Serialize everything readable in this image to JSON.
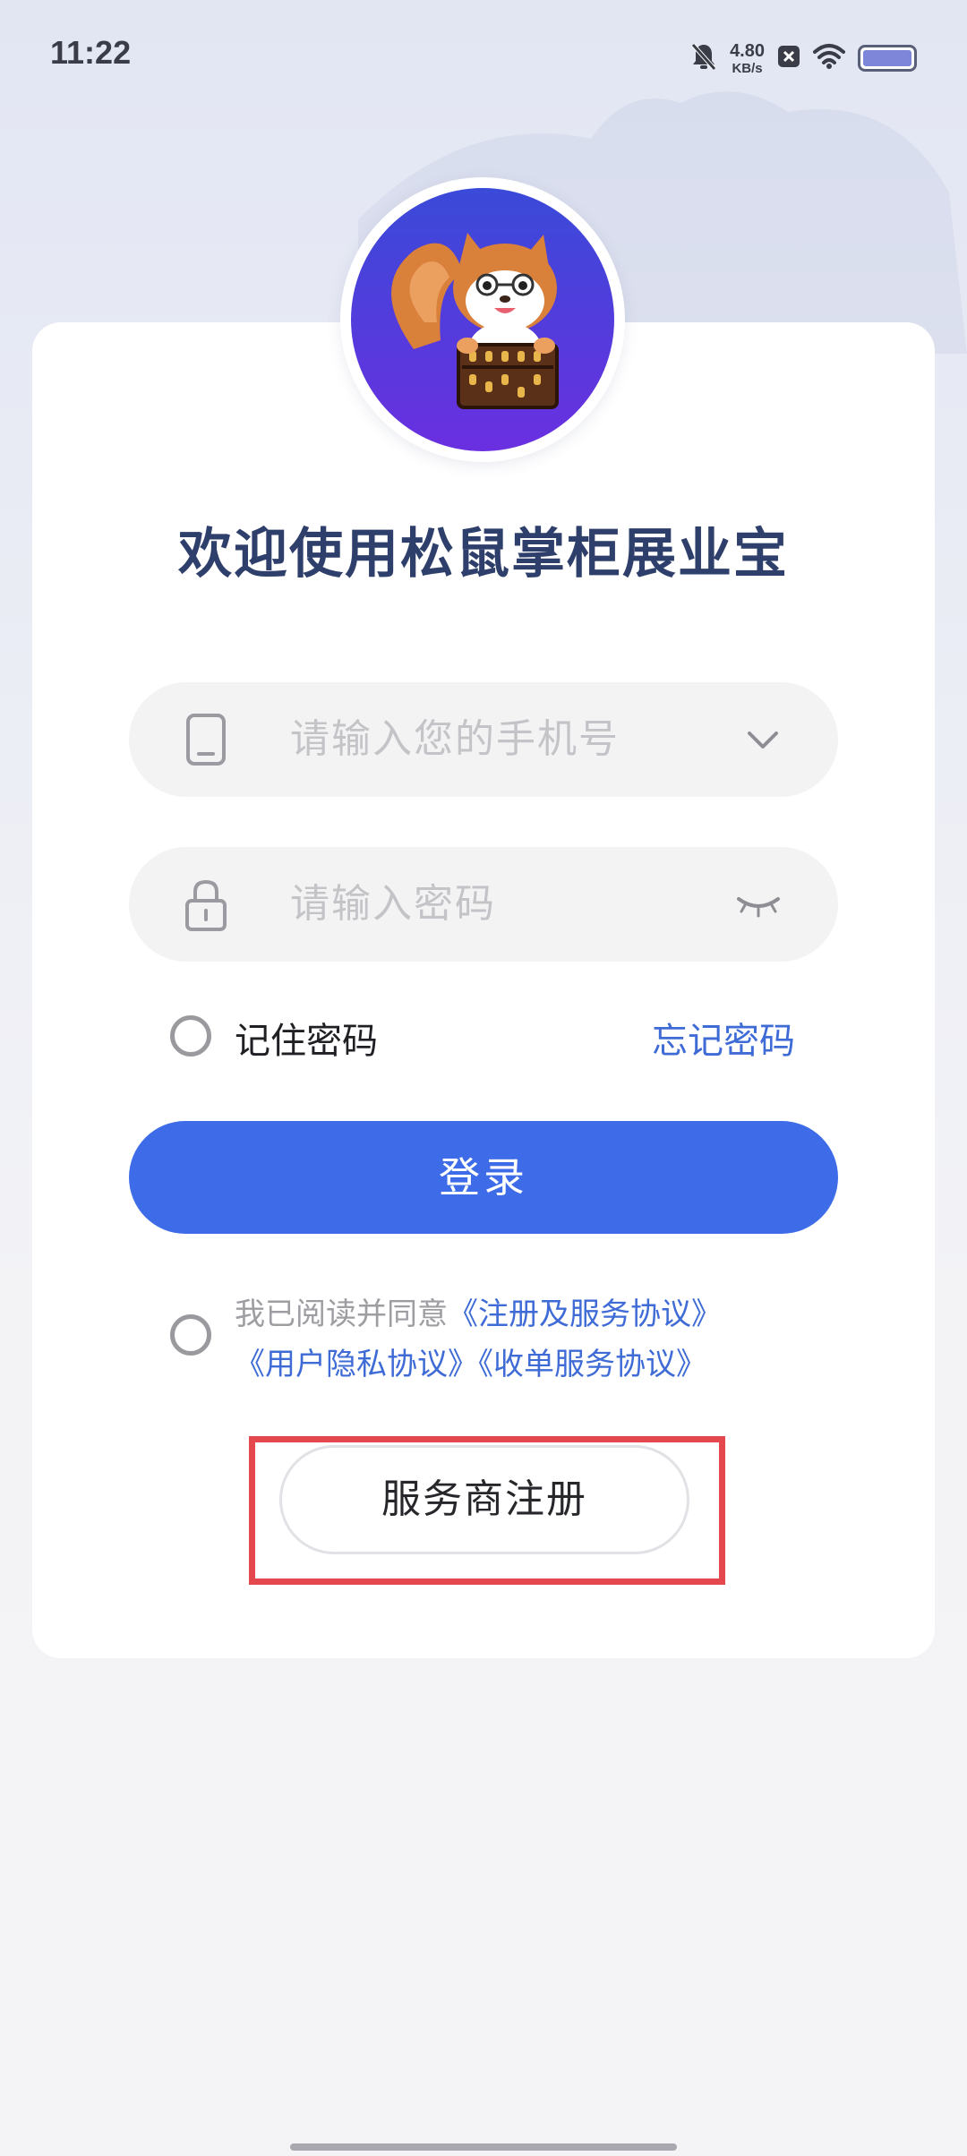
{
  "status_bar": {
    "time": "11:22",
    "net_speed_value": "4.80",
    "net_speed_unit": "KB/s",
    "icons": [
      "bell-muted-icon",
      "close-box-icon",
      "wifi-icon",
      "battery-icon"
    ]
  },
  "app": {
    "logo": "squirrel-abacus-mascot",
    "title": "欢迎使用松鼠掌柜展业宝"
  },
  "form": {
    "phone": {
      "placeholder": "请输入您的手机号",
      "lead_icon": "phone-icon",
      "trail_icon": "chevron-down-icon"
    },
    "password": {
      "placeholder": "请输入密码",
      "lead_icon": "lock-icon",
      "trail_icon": "eye-closed-icon"
    },
    "remember_label": "记住密码",
    "forgot_label": "忘记密码",
    "login_label": "登录"
  },
  "agreement": {
    "prefix": "我已阅读并同意",
    "links": [
      "《注册及服务协议》",
      "《用户隐私协议》",
      "《收单服务协议》"
    ]
  },
  "register_label": "服务商注册",
  "colors": {
    "primary": "#3e6ce8",
    "link": "#3f6bd6",
    "title": "#2e3f6b",
    "highlight": "#e5474f"
  }
}
